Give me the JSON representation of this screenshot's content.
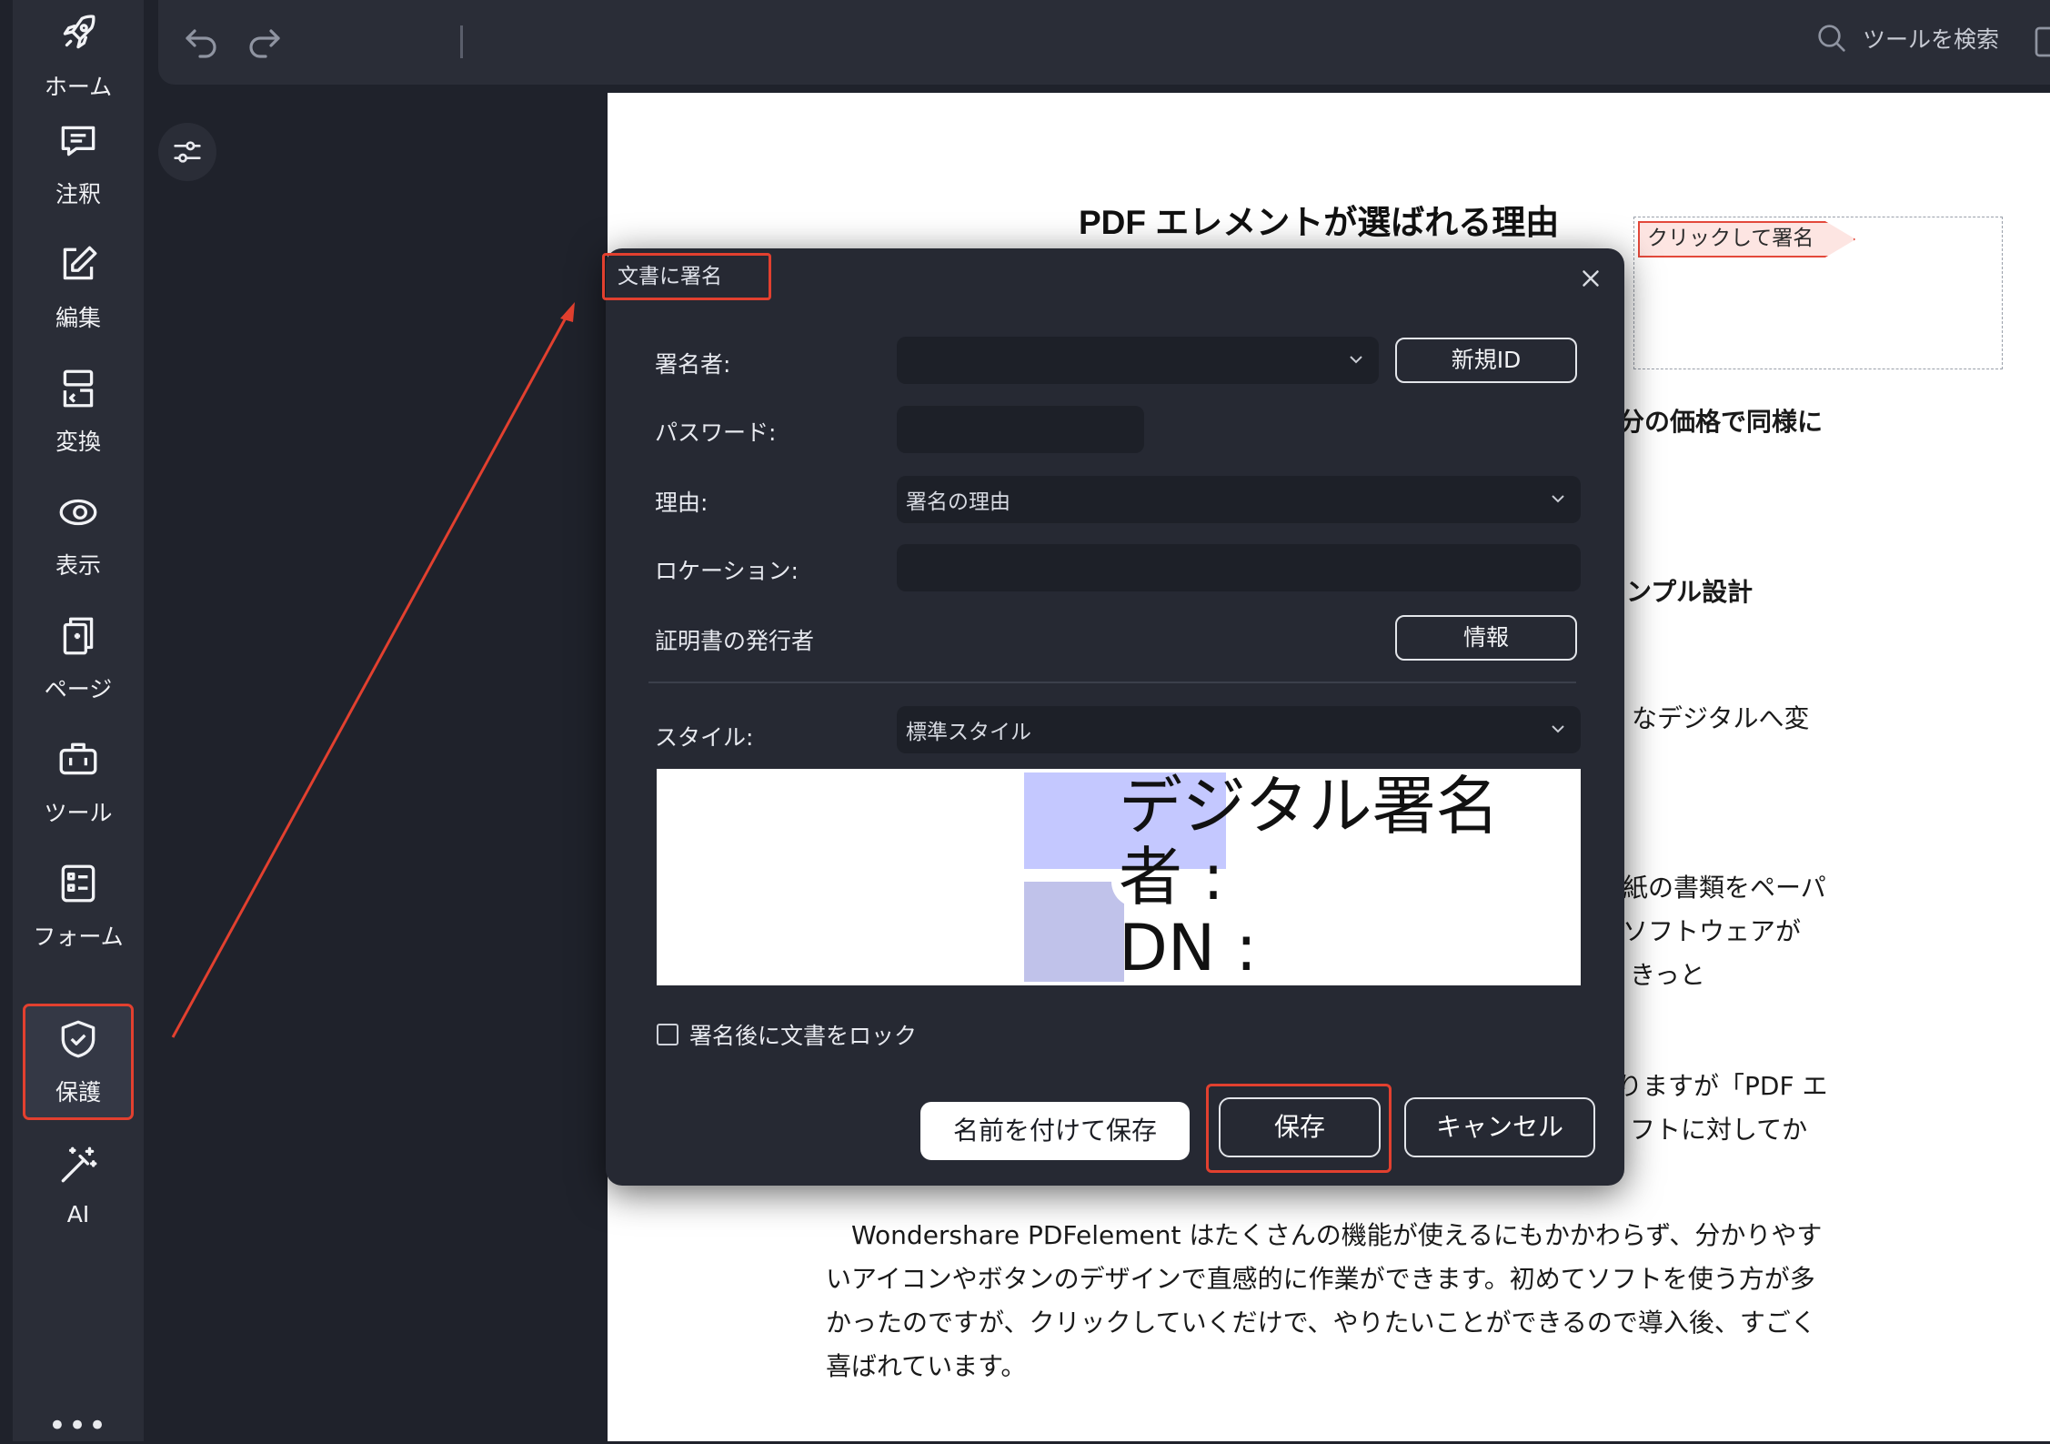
{
  "sidebar": {
    "items": [
      {
        "label": "ホーム",
        "icon": "rocket-icon"
      },
      {
        "label": "注釈",
        "icon": "comment-icon"
      },
      {
        "label": "編集",
        "icon": "edit-icon"
      },
      {
        "label": "変換",
        "icon": "convert-icon"
      },
      {
        "label": "表示",
        "icon": "eye-icon"
      },
      {
        "label": "ページ",
        "icon": "pages-icon"
      },
      {
        "label": "ツール",
        "icon": "toolbox-icon"
      },
      {
        "label": "フォーム",
        "icon": "form-icon"
      },
      {
        "label": "保護",
        "icon": "shield-check-icon"
      },
      {
        "label": "AI",
        "icon": "magic-wand-icon"
      }
    ],
    "more": "•••"
  },
  "toolbar": {
    "search_label": "ツールを検索"
  },
  "document": {
    "title": "PDF エレメントが選ばれる理由",
    "sign_tag": "クリックして署名",
    "fragments": [
      "分の価格で同様に",
      "ンプル設計",
      "なデジタルへ変",
      "紙の書類をペーパ",
      "ソフトウェアが",
      "きっと",
      "りますが「PDF エ",
      "フトに対してか"
    ],
    "paragraph": "　Wondershare PDFelement はたくさんの機能が使えるにもかかわらず、分かりやすいアイコンやボタンのデザインで直感的に作業ができます。初めてソフトを使う方が多かったのですが、クリックしていくだけで、やりたいことができるので導入後、すごく喜ばれています。"
  },
  "dialog": {
    "title": "文書に署名",
    "signer_label": "署名者:",
    "signer_value": "",
    "new_id_button": "新規ID",
    "password_label": "パスワード:",
    "password_value": "",
    "reason_label": "理由:",
    "reason_value": "署名の理由",
    "location_label": "ロケーション:",
    "location_value": "",
    "issuer_label": "証明書の発行者",
    "info_button": "情報",
    "style_label": "スタイル:",
    "style_value": "標準スタイル",
    "preview_lines": [
      "デジタル署名",
      "者 :",
      "DN :"
    ],
    "lock_label": "署名後に文書をロック",
    "lock_checked": false,
    "save_as_button": "名前を付けて保存",
    "save_button": "保存",
    "cancel_button": "キャンセル"
  },
  "colors": {
    "highlight_red": "#e2402f",
    "sidebar_bg": "#2a2d37",
    "dialog_bg": "#262933"
  }
}
